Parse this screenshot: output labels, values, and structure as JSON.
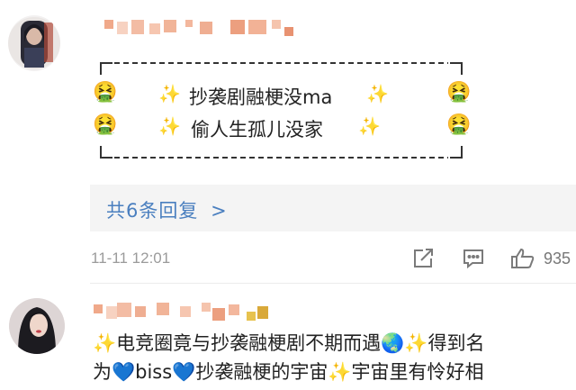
{
  "comment1": {
    "avatar_icon": "user-avatar-photo",
    "lines": [
      "抄袭剧融梗没ma",
      "偷人生孤儿没家"
    ],
    "emoji_left": "🤮",
    "emoji_right": "🤮",
    "sparkle": "✨",
    "replies_label": "共6条回复",
    "replies_arrow": ">",
    "timestamp": "11-11 12:01",
    "likes": "935"
  },
  "comment2": {
    "avatar_icon": "user-avatar-photo",
    "text_line1": "✨电竞圈竟与抄袭融梗剧不期而遇🌏✨得到名",
    "text_line2": "为💙biss💙抄袭融梗的宇宙✨宇宙里有怜好相"
  },
  "colors": {
    "link": "#4a7fbf",
    "muted": "#9b9b9b",
    "reply_bg": "#f4f4f4"
  },
  "icons": [
    "share-icon",
    "comment-icon",
    "like-icon"
  ]
}
